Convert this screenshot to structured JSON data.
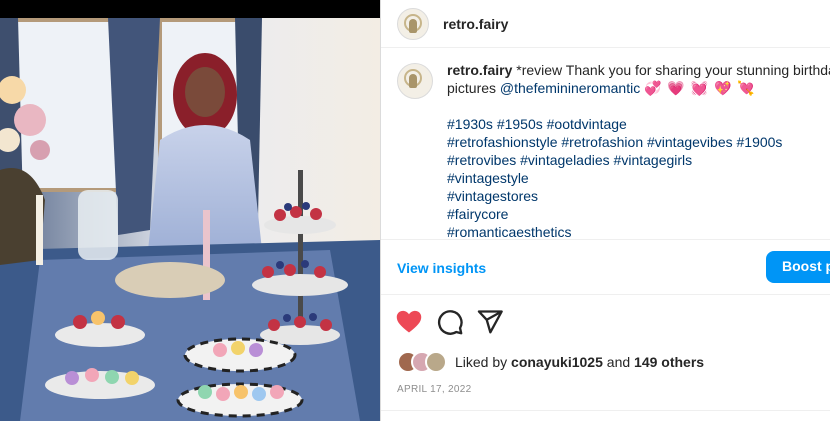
{
  "post": {
    "username": "retro.fairy",
    "caption": {
      "username": "retro.fairy",
      "line1": "*review Thank you for sharing your stunning birthday",
      "line2_prefix": "pictures ",
      "mention": "@thefeminineromantic",
      "hearts": [
        "💞",
        "💗",
        "💓",
        "💖",
        "💘"
      ],
      "hashtags": [
        "#1930s #1950s #ootdvintage",
        "#retrofashionstyle #retrofashion #vintagevibes #1900s",
        "#retrovibes #vintageladies #vintagegirls",
        "#vintagestyle",
        "#vintagestores",
        "#fairycore",
        "#romanticaesthetics"
      ]
    },
    "insights": {
      "view_label": "View insights",
      "boost_label": "Boost post"
    },
    "actions": {
      "like_icon": "heart-filled-icon",
      "comment_icon": "comment-icon",
      "share_icon": "share-icon",
      "like_color": "#ed4956"
    },
    "likes": {
      "prefix": "Liked by ",
      "user": "conayuki1025",
      "middle": " and ",
      "others": "149 others"
    },
    "date": "April 17, 2022"
  },
  "colors": {
    "link": "#00376b",
    "accent": "#0095f6",
    "muted": "#8e8e8e"
  }
}
